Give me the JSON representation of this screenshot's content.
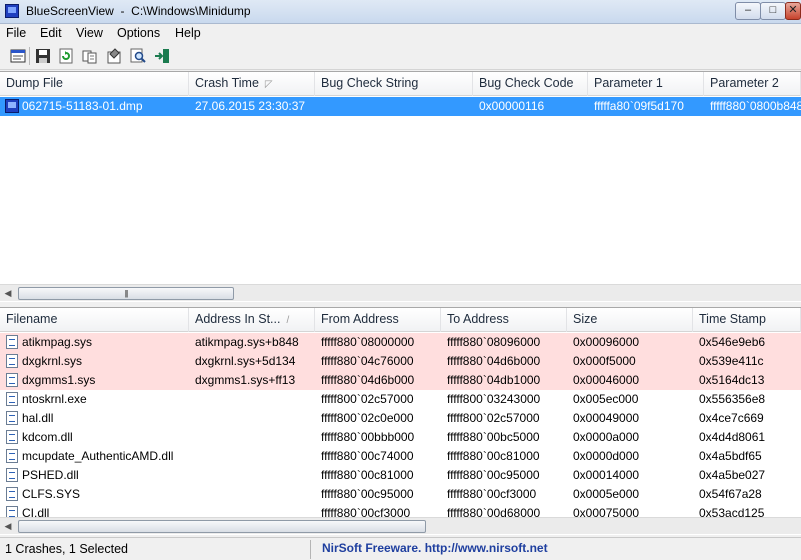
{
  "window": {
    "title": "BlueScreenView  -  C:\\Windows\\Minidump",
    "minimize_label": "–",
    "maximize_label": "□",
    "close_label": "✕"
  },
  "menu": [
    "File",
    "Edit",
    "View",
    "Options",
    "Help"
  ],
  "toolbar": [
    "options-icon",
    "save-icon",
    "refresh-icon",
    "copy-icon",
    "properties-icon",
    "find-icon",
    "exit-icon"
  ],
  "crashes": {
    "columns": [
      "Dump File",
      "Crash Time",
      "Bug Check String",
      "Bug Check Code",
      "Parameter 1",
      "Parameter 2"
    ],
    "sort_glyph": "◸",
    "rows": [
      [
        "062715-51183-01.dmp",
        "27.06.2015 23:30:37",
        "",
        "0x00000116",
        "fffffa80`09f5d170",
        "fffff880`0800b848"
      ]
    ]
  },
  "drivers": {
    "columns": [
      "Filename",
      "Address In St...",
      "From Address",
      "To Address",
      "Size",
      "Time Stamp"
    ],
    "sort_glyph": "/",
    "rows": [
      {
        "cells": [
          "atikmpag.sys",
          "atikmpag.sys+b848",
          "fffff880`08000000",
          "fffff880`08096000",
          "0x00096000",
          "0x546e9eb6"
        ],
        "highlight": true
      },
      {
        "cells": [
          "dxgkrnl.sys",
          "dxgkrnl.sys+5d134",
          "fffff880`04c76000",
          "fffff880`04d6b000",
          "0x000f5000",
          "0x539e411c"
        ],
        "highlight": true
      },
      {
        "cells": [
          "dxgmms1.sys",
          "dxgmms1.sys+ff13",
          "fffff880`04d6b000",
          "fffff880`04db1000",
          "0x00046000",
          "0x5164dc13"
        ],
        "highlight": true
      },
      {
        "cells": [
          "ntoskrnl.exe",
          "",
          "fffff800`02c57000",
          "fffff800`03243000",
          "0x005ec000",
          "0x556356e8"
        ],
        "highlight": false
      },
      {
        "cells": [
          "hal.dll",
          "",
          "fffff800`02c0e000",
          "fffff800`02c57000",
          "0x00049000",
          "0x4ce7c669"
        ],
        "highlight": false
      },
      {
        "cells": [
          "kdcom.dll",
          "",
          "fffff880`00bbb000",
          "fffff880`00bc5000",
          "0x0000a000",
          "0x4d4d8061"
        ],
        "highlight": false
      },
      {
        "cells": [
          "mcupdate_AuthenticAMD.dll",
          "",
          "fffff880`00c74000",
          "fffff880`00c81000",
          "0x0000d000",
          "0x4a5bdf65"
        ],
        "highlight": false
      },
      {
        "cells": [
          "PSHED.dll",
          "",
          "fffff880`00c81000",
          "fffff880`00c95000",
          "0x00014000",
          "0x4a5be027"
        ],
        "highlight": false
      },
      {
        "cells": [
          "CLFS.SYS",
          "",
          "fffff880`00c95000",
          "fffff880`00cf3000",
          "0x0005e000",
          "0x54f67a28"
        ],
        "highlight": false
      },
      {
        "cells": [
          "CI.dll",
          "",
          "fffff880`00cf3000",
          "fffff880`00d68000",
          "0x00075000",
          "0x53acd125"
        ],
        "highlight": false
      }
    ]
  },
  "scrollbar": {
    "left_arrow": "◀",
    "right_arrow": "▶",
    "grip": "|||"
  },
  "status": {
    "left": "1 Crashes, 1 Selected",
    "right": "NirSoft Freeware.  http://www.nirsoft.net"
  }
}
